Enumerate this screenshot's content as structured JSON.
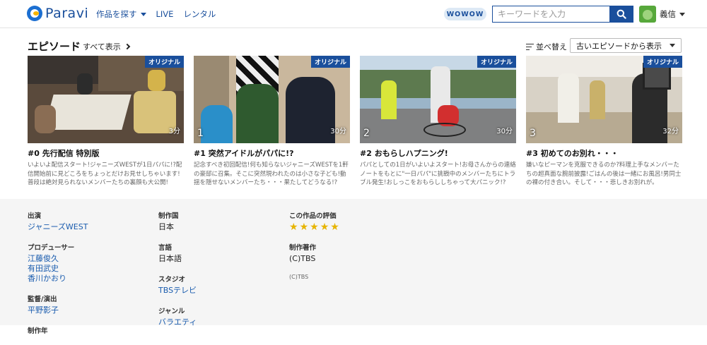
{
  "header": {
    "logo_text": "Paravi",
    "nav": [
      {
        "label": "作品を探す",
        "has_dropdown": true
      },
      {
        "label": "LIVE",
        "has_dropdown": false
      },
      {
        "label": "レンタル",
        "has_dropdown": false
      }
    ],
    "wowow_label": "WOWOW",
    "search_placeholder": "キーワードを入力",
    "user_name": "義信"
  },
  "episodes_section": {
    "title": "エピソード",
    "see_all": "すべて表示",
    "sort_label": "並べ替え",
    "sort_selected": "古いエピソードから表示",
    "badge_label": "オリジナル",
    "items": [
      {
        "overlay_number": "",
        "duration": "3分",
        "title": "#0 先行配信 特別版",
        "desc": "いよいよ配信スタート!ジャニーズWESTが1日パパに!?配信開始前に見どころをちょっとだけお見せしちゃいます!普段は絶対見られないメンバーたちの裏顔も大公開!"
      },
      {
        "overlay_number": "1",
        "duration": "30分",
        "title": "#1 突然アイドルがパパに!?",
        "desc": "記念すべき初回配信!何も知らないジャニーズWESTを1軒の豪邸に召集。そこに突然現われたのは小さな子ども!動揺を隠せないメンバーたち・・・果たしてどうなる!?"
      },
      {
        "overlay_number": "2",
        "duration": "30分",
        "title": "#2 おもらしハプニング!",
        "desc": "パパとしての1日がいよいよスタート!お母さんからの連絡ノートをもとに\"一日パパ\"に挑戦中のメンバーたちにトラブル発生!おしっこをおもらししちゃって大パニック!?"
      },
      {
        "overlay_number": "3",
        "duration": "32分",
        "title": "#3 初めてのお別れ・・・",
        "desc": "嫌いなピーマンを克服できるのか?料理上手なメンバーたちの超真面な腕前披露!ごはんの後は一緒にお風呂!男同士の裸の付き合い。そして・・・悲しきお別れが。"
      }
    ]
  },
  "info": {
    "cast_label": "出演",
    "cast": [
      "ジャニーズWEST"
    ],
    "producer_label": "プロデューサー",
    "producers": [
      "江藤俊久",
      "有田武史",
      "香川かおり"
    ],
    "director_label": "監督/演出",
    "directors": [
      "平野影子"
    ],
    "year_label": "制作年",
    "country_label": "制作国",
    "country": "日本",
    "language_label": "言語",
    "language": "日本語",
    "studio_label": "スタジオ",
    "studio": "TBSテレビ",
    "genre_label": "ジャンル",
    "genre": "バラエティ",
    "rating_label": "この作品の評価",
    "rating_stars": 5,
    "copyright_label": "制作著作",
    "copyright": "(C)TBS",
    "copyright_small": "(C)TBS"
  },
  "colors": {
    "brand": "#1a4f9c",
    "link": "#1a5cae",
    "star": "#e6b400"
  }
}
